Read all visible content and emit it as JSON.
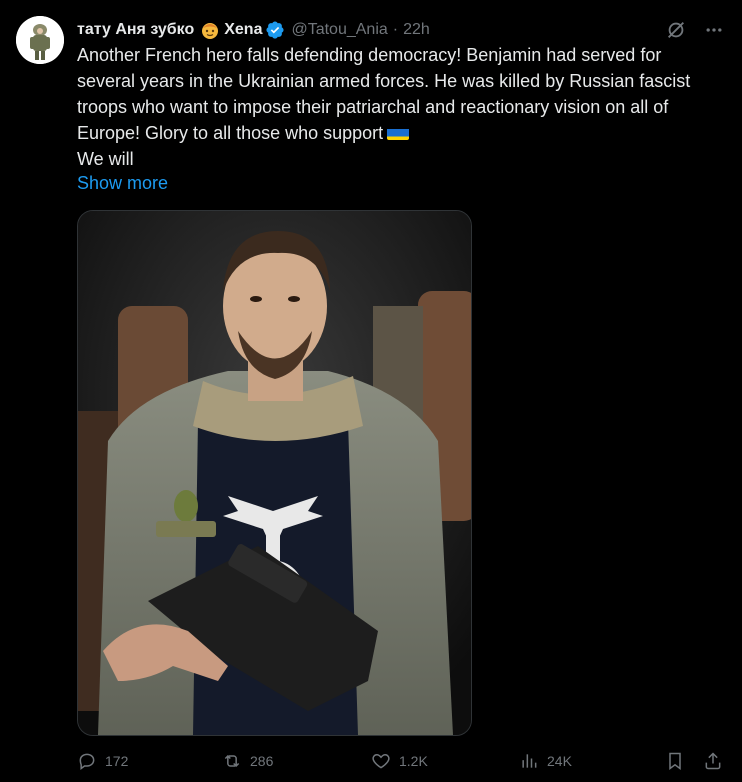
{
  "tweet": {
    "display_name": "тату Аня зубко",
    "display_name_suffix": "Xena",
    "handle": "@Tatou_Ania",
    "separator": "·",
    "time": "22h",
    "text_lines": [
      "Another French hero falls defending democracy! Benjamin had served for several years in the Ukrainian armed forces. He was killed by Russian fascist troops who want to impose their patriarchal and reactionary vision on all of Europe! Glory to all those who support",
      "We will"
    ],
    "show_more": "Show more",
    "flag_icon": "ukraine-flag-emoji",
    "badge_icon": "verified-badge-icon",
    "accent": "#1d9bf0"
  },
  "actions": {
    "replies": "172",
    "reposts": "286",
    "likes": "1.2K",
    "views": "24K"
  }
}
